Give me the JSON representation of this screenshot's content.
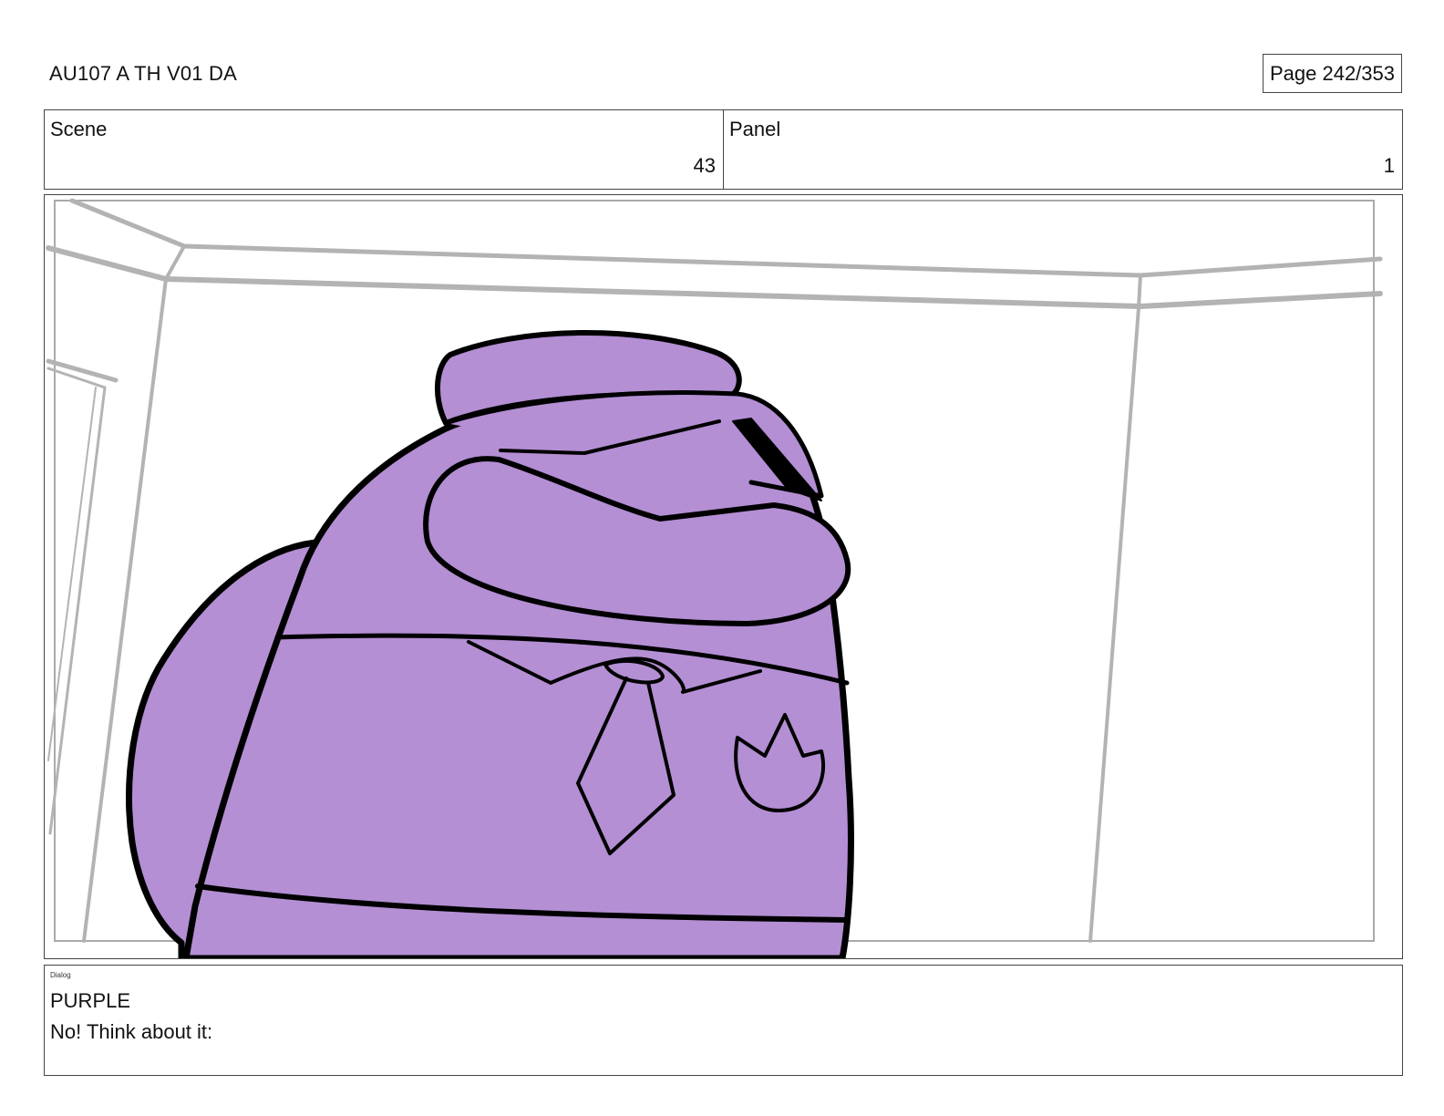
{
  "header": {
    "doc_title": "AU107 A TH V01 DA",
    "page_counter": "Page 242/353"
  },
  "info": {
    "scene_label": "Scene",
    "scene_value": "43",
    "panel_label": "Panel",
    "panel_value": "1"
  },
  "dialog": {
    "tag": "Dialog",
    "speaker": "PURPLE",
    "line": "No! Think about it:"
  },
  "colors": {
    "character_fill": "#b48fd4",
    "outline": "#000000",
    "set_lines": "#b3b3b3"
  }
}
